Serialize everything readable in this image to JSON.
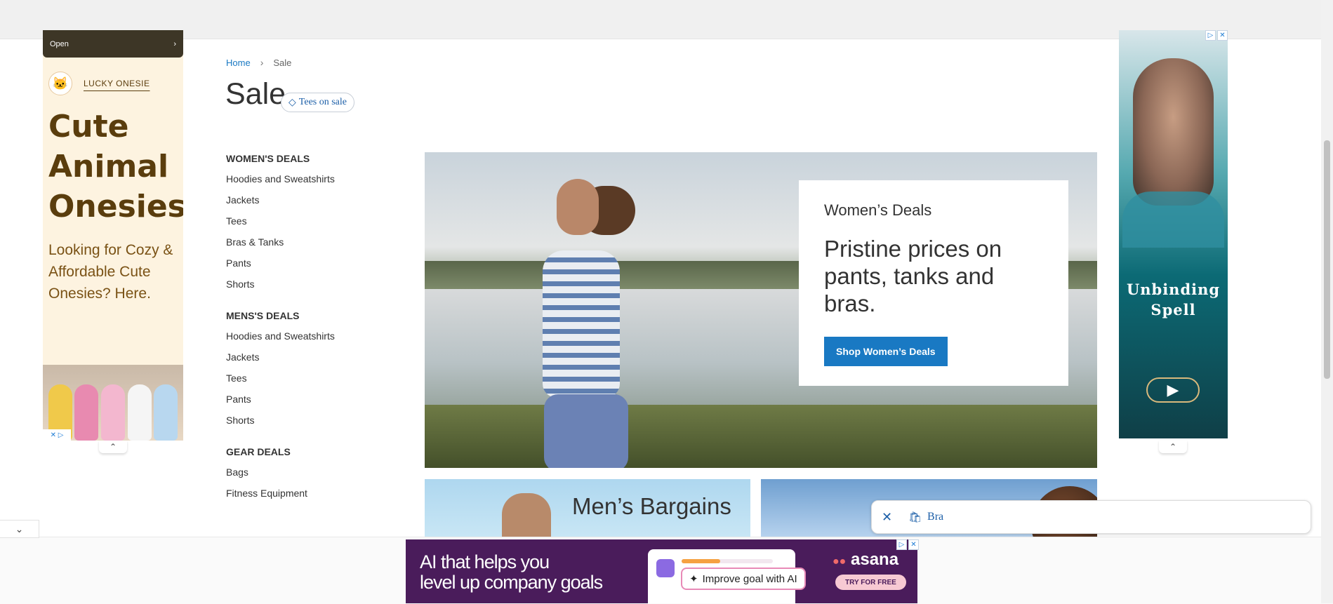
{
  "left_ad": {
    "open_label": "Open",
    "brand": "LUCKY ONESIE",
    "headline": "Cute Animal Onesies",
    "subtext": "Looking for Cozy & Affordable Cute Onesies? Here.",
    "logo_glyph": "🐱",
    "adchoices": "✕ ▷"
  },
  "right_ad": {
    "title": "Unbinding Spell",
    "play_glyph": "▶"
  },
  "breadcrumb": {
    "home": "Home",
    "separator": "›",
    "current": "Sale"
  },
  "page": {
    "title": "Sale",
    "tag_chip": "Tees on sale",
    "tag_icon": "◇"
  },
  "sidebar": {
    "groups": [
      {
        "title": "WOMEN'S DEALS",
        "items": [
          "Hoodies and Sweatshirts",
          "Jackets",
          "Tees",
          "Bras & Tanks",
          "Pants",
          "Shorts"
        ]
      },
      {
        "title": "MENS'S DEALS",
        "items": [
          "Hoodies and Sweatshirts",
          "Jackets",
          "Tees",
          "Pants",
          "Shorts"
        ]
      },
      {
        "title": "GEAR DEALS",
        "items": [
          "Bags",
          "Fitness Equipment"
        ]
      }
    ]
  },
  "hero": {
    "eyebrow": "Women’s Deals",
    "headline": "Pristine prices on pants, tanks and bras.",
    "cta": "Shop Women’s Deals"
  },
  "tiles": {
    "men_title": "Men’s Bargains"
  },
  "search_chip": {
    "close_icon": "✕",
    "bag_icon": "🛍",
    "text": "Bra"
  },
  "bottom_ad": {
    "copy_line1": "AI that helps you",
    "copy_line2": "level up company goals",
    "pill": "Improve goal with AI",
    "pill_icon": "✦",
    "brand": "asana",
    "brand_dots": "●●",
    "try": "TRY FOR FREE"
  },
  "colors": {
    "link": "#1979c3",
    "cta_bg": "#1979c3",
    "ad_purple": "#4a1c5b"
  }
}
